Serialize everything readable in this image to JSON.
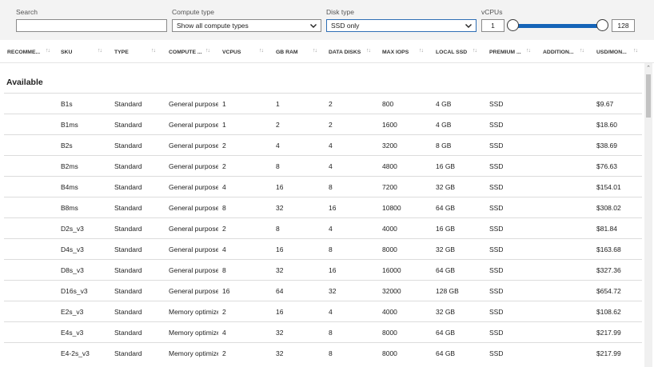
{
  "filters": {
    "search_label": "Search",
    "search_value": "",
    "compute_type_label": "Compute type",
    "compute_type_value": "Show all compute types",
    "disk_type_label": "Disk type",
    "disk_type_value": "SSD only",
    "vcpus_label": "vCPUs",
    "vcpus_min": "1",
    "vcpus_max": "128"
  },
  "columns": [
    "RECOMME...",
    "SKU",
    "TYPE",
    "COMPUTE ...",
    "VCPUS",
    "GB RAM",
    "DATA DISKS",
    "MAX IOPS",
    "LOCAL SSD",
    "PREMIUM ...",
    "ADDITION...",
    "USD/MON..."
  ],
  "section_label": "Available",
  "rows": [
    {
      "sku": "B1s",
      "type": "Standard",
      "compute": "General purpose",
      "vcpus": "1",
      "ram": "1",
      "disks": "2",
      "iops": "800",
      "ssd": "4 GB",
      "premium": "SSD",
      "additional": "",
      "price": "$9.67"
    },
    {
      "sku": "B1ms",
      "type": "Standard",
      "compute": "General purpose",
      "vcpus": "1",
      "ram": "2",
      "disks": "2",
      "iops": "1600",
      "ssd": "4 GB",
      "premium": "SSD",
      "additional": "",
      "price": "$18.60"
    },
    {
      "sku": "B2s",
      "type": "Standard",
      "compute": "General purpose",
      "vcpus": "2",
      "ram": "4",
      "disks": "4",
      "iops": "3200",
      "ssd": "8 GB",
      "premium": "SSD",
      "additional": "",
      "price": "$38.69"
    },
    {
      "sku": "B2ms",
      "type": "Standard",
      "compute": "General purpose",
      "vcpus": "2",
      "ram": "8",
      "disks": "4",
      "iops": "4800",
      "ssd": "16 GB",
      "premium": "SSD",
      "additional": "",
      "price": "$76.63"
    },
    {
      "sku": "B4ms",
      "type": "Standard",
      "compute": "General purpose",
      "vcpus": "4",
      "ram": "16",
      "disks": "8",
      "iops": "7200",
      "ssd": "32 GB",
      "premium": "SSD",
      "additional": "",
      "price": "$154.01"
    },
    {
      "sku": "B8ms",
      "type": "Standard",
      "compute": "General purpose",
      "vcpus": "8",
      "ram": "32",
      "disks": "16",
      "iops": "10800",
      "ssd": "64 GB",
      "premium": "SSD",
      "additional": "",
      "price": "$308.02"
    },
    {
      "sku": "D2s_v3",
      "type": "Standard",
      "compute": "General purpose",
      "vcpus": "2",
      "ram": "8",
      "disks": "4",
      "iops": "4000",
      "ssd": "16 GB",
      "premium": "SSD",
      "additional": "",
      "price": "$81.84"
    },
    {
      "sku": "D4s_v3",
      "type": "Standard",
      "compute": "General purpose",
      "vcpus": "4",
      "ram": "16",
      "disks": "8",
      "iops": "8000",
      "ssd": "32 GB",
      "premium": "SSD",
      "additional": "",
      "price": "$163.68"
    },
    {
      "sku": "D8s_v3",
      "type": "Standard",
      "compute": "General purpose",
      "vcpus": "8",
      "ram": "32",
      "disks": "16",
      "iops": "16000",
      "ssd": "64 GB",
      "premium": "SSD",
      "additional": "",
      "price": "$327.36"
    },
    {
      "sku": "D16s_v3",
      "type": "Standard",
      "compute": "General purpose",
      "vcpus": "16",
      "ram": "64",
      "disks": "32",
      "iops": "32000",
      "ssd": "128 GB",
      "premium": "SSD",
      "additional": "",
      "price": "$654.72"
    },
    {
      "sku": "E2s_v3",
      "type": "Standard",
      "compute": "Memory optimized",
      "vcpus": "2",
      "ram": "16",
      "disks": "4",
      "iops": "4000",
      "ssd": "32 GB",
      "premium": "SSD",
      "additional": "",
      "price": "$108.62"
    },
    {
      "sku": "E4s_v3",
      "type": "Standard",
      "compute": "Memory optimized",
      "vcpus": "4",
      "ram": "32",
      "disks": "8",
      "iops": "8000",
      "ssd": "64 GB",
      "premium": "SSD",
      "additional": "",
      "price": "$217.99"
    },
    {
      "sku": "E4-2s_v3",
      "type": "Standard",
      "compute": "Memory optimized",
      "vcpus": "2",
      "ram": "32",
      "disks": "8",
      "iops": "8000",
      "ssd": "64 GB",
      "premium": "SSD",
      "additional": "",
      "price": "$217.99"
    }
  ],
  "icons": {
    "dropdown": "chevron-down-icon",
    "sort": "sort-arrows-icon",
    "scroll_up": "scroll-up-arrow-icon"
  },
  "colors": {
    "accent": "#1564b8",
    "filter_bg": "#f3f3f3",
    "row_divider": "#dcdcdc"
  }
}
